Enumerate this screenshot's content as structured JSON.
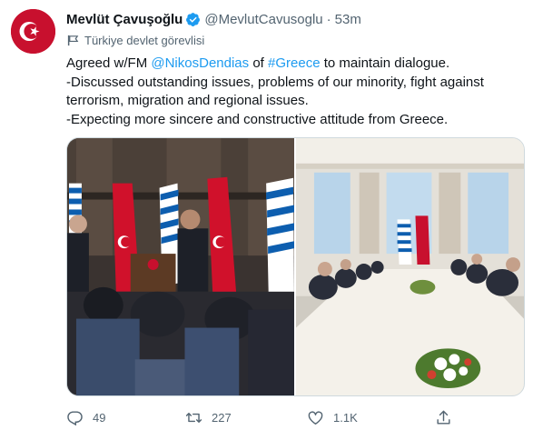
{
  "tweet": {
    "author": {
      "display_name": "Mevlüt Çavuşoğlu",
      "handle": "@MevlutCavusoglu",
      "time": "53m",
      "verified": true,
      "label": "Türkiye devlet görevlisi"
    },
    "text": {
      "line1_prefix": "Agreed w/FM ",
      "mention": "@NikosDendias",
      "line1_mid": " of ",
      "hashtag": "#Greece",
      "line1_suffix": " to maintain dialogue.",
      "line2": "-Discussed outstanding issues, problems of our minority, fight against",
      "line3": "terrorism, migration and regional issues.",
      "line4": "-Expecting more sincere and constructive attitude from Greece."
    },
    "actions": {
      "replies": "49",
      "retweets": "227",
      "likes": "1.1K"
    },
    "colors": {
      "link": "#1d9bf0",
      "secondary_text": "#536471",
      "verified": "#1d9bf0",
      "turkey_red": "#c8102e"
    },
    "icons": {
      "reply": "reply-icon",
      "retweet": "retweet-icon",
      "like": "heart-icon",
      "share": "share-icon",
      "verified": "verified-badge-icon",
      "label": "government-label-icon"
    }
  }
}
